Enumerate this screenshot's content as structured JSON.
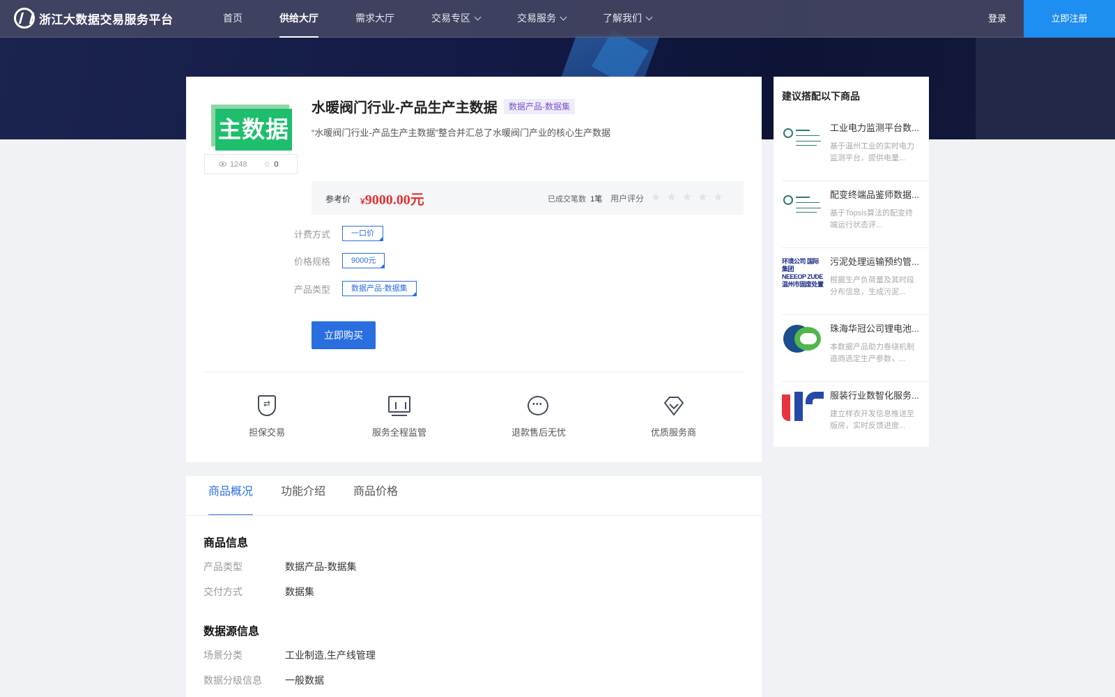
{
  "header": {
    "logo_text": "浙江大数据交易服务平台",
    "nav": [
      {
        "label": "首页",
        "active": false,
        "dropdown": false
      },
      {
        "label": "供给大厅",
        "active": true,
        "dropdown": false
      },
      {
        "label": "需求大厅",
        "active": false,
        "dropdown": false
      },
      {
        "label": "交易专区",
        "active": false,
        "dropdown": true
      },
      {
        "label": "交易服务",
        "active": false,
        "dropdown": true
      },
      {
        "label": "了解我们",
        "active": false,
        "dropdown": true
      }
    ],
    "login": "登录",
    "register": "立即注册"
  },
  "product": {
    "image_text": "主数据",
    "views": "1248",
    "favorites": "0",
    "title": "水暖阀门行业-产品生产主数据",
    "tag": "数据产品-数据集",
    "description": "“水暖阀门行业-产品生产主数据”整合并汇总了水暖阀门产业的核心生产数据",
    "price_label": "参考价",
    "price_symbol": "¥",
    "price": "9000.00元",
    "deals_label": "已成交笔数",
    "deals_value": "1笔",
    "rating_label": "用户评分",
    "rating": 0,
    "rating_max": 5,
    "specs": [
      {
        "label": "计费方式",
        "value": "一口价"
      },
      {
        "label": "价格规格",
        "value": "9000元"
      },
      {
        "label": "产品类型",
        "value": "数据产品-数据集"
      }
    ],
    "buy_button": "立即购买"
  },
  "features": [
    {
      "icon": "shield-icon",
      "label": "担保交易"
    },
    {
      "icon": "monitor-icon",
      "label": "服务全程监管"
    },
    {
      "icon": "chat-icon",
      "label": "退款售后无忧"
    },
    {
      "icon": "diamond-icon",
      "label": "优质服务商"
    }
  ],
  "recommend": {
    "title": "建议搭配以下商品",
    "items": [
      {
        "name": "工业电力监测平台数...",
        "desc": "基于温州工业的实时电力监测平台，提供电量...",
        "logo": "state-grid-logo"
      },
      {
        "name": "配变终端品鉴师数据...",
        "desc": "基于Topsis算法的配变终端运行状态评...",
        "logo": "state-grid-logo"
      },
      {
        "name": "污泥处理运输预约管...",
        "desc": "根据生产负荷量及其时段分布信息，生成污泥...",
        "logo": "pw-logo"
      },
      {
        "name": "珠海华冠公司锂电池...",
        "desc": "本数据产品助力卷绕机制造商选定生产参数，...",
        "logo": "hg-logo"
      },
      {
        "name": "服装行业数智化服务...",
        "desc": "建立样衣开发信息推送至版房，实时反馈进度...",
        "logo": "ir-logo"
      }
    ]
  },
  "pw_logo_text": [
    "环境公司 国际集团",
    "NEEEOP  ZUDE",
    "温州市固废处置有限公司"
  ],
  "tabs": [
    {
      "label": "商品概况",
      "active": true
    },
    {
      "label": "功能介绍",
      "active": false
    },
    {
      "label": "商品价格",
      "active": false
    }
  ],
  "details": {
    "section1_title": "商品信息",
    "section1": [
      {
        "key": "产品类型",
        "value": "数据产品-数据集"
      },
      {
        "key": "交付方式",
        "value": "数据集"
      }
    ],
    "section2_title": "数据源信息",
    "section2": [
      {
        "key": "场景分类",
        "value": "工业制造,生产线管理"
      },
      {
        "key": "数据分级信息",
        "value": "一般数据"
      }
    ]
  }
}
